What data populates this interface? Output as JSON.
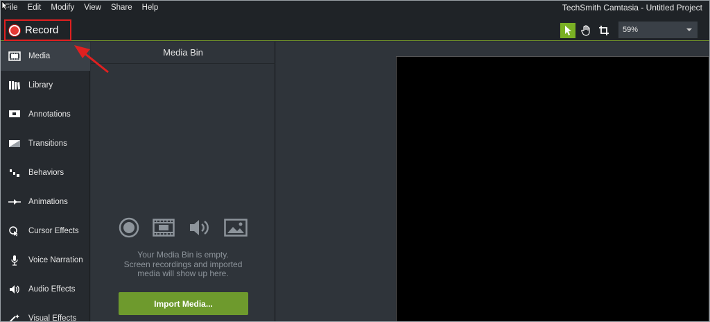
{
  "menubar": {
    "items": [
      "File",
      "Edit",
      "Modify",
      "View",
      "Share",
      "Help"
    ],
    "app_title": "TechSmith Camtasia - Untitled Project"
  },
  "toolbar": {
    "record_label": "Record",
    "zoom_value": "59%"
  },
  "sidebar": {
    "items": [
      {
        "label": "Media",
        "icon": "film-icon"
      },
      {
        "label": "Library",
        "icon": "books-icon"
      },
      {
        "label": "Annotations",
        "icon": "annotation-icon"
      },
      {
        "label": "Transitions",
        "icon": "transition-icon"
      },
      {
        "label": "Behaviors",
        "icon": "behaviors-icon"
      },
      {
        "label": "Animations",
        "icon": "animation-icon"
      },
      {
        "label": "Cursor Effects",
        "icon": "cursor-effects-icon"
      },
      {
        "label": "Voice Narration",
        "icon": "microphone-icon"
      },
      {
        "label": "Audio Effects",
        "icon": "speaker-icon"
      },
      {
        "label": "Visual Effects",
        "icon": "visual-effects-icon"
      }
    ]
  },
  "media_bin": {
    "title": "Media Bin",
    "empty_line1": "Your Media Bin is empty.",
    "empty_line2": "Screen recordings and imported",
    "empty_line3": "media will show up here.",
    "import_label": "Import Media..."
  },
  "colors": {
    "accent_green": "#7ab024",
    "record_red": "#e53935",
    "highlight_box": "#e02020"
  }
}
